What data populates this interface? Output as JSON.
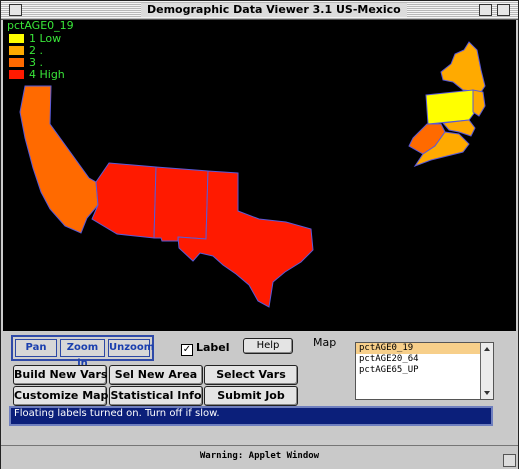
{
  "window": {
    "title": "Demographic Data Viewer 3.1 US-Mexico"
  },
  "map": {
    "variable_title": "pctAGE0_19",
    "legend": [
      {
        "label": "1  Low",
        "color": "#ffff00"
      },
      {
        "label": "2  .",
        "color": "#ffaa00"
      },
      {
        "label": "3  .",
        "color": "#ff6a00"
      },
      {
        "label": "4  High",
        "color": "#ff1a00"
      }
    ]
  },
  "nav": {
    "pan": "Pan",
    "zoom_in": "Zoom in",
    "unzoom": "Unzoom"
  },
  "label_toggle": {
    "label": "Label",
    "checked": true,
    "mark": "✓"
  },
  "help": "Help",
  "map_label": "Map",
  "buttons": {
    "build_new_vars": "Build New Vars",
    "sel_new_area": "Sel New Area",
    "select_vars": "Select Vars",
    "customize_map": "Customize Map",
    "statistical_info": "Statistical Info",
    "submit_job": "Submit Job"
  },
  "variables": [
    "pctAGE0_19",
    "pctAGE20_64",
    "pctAGE65_UP"
  ],
  "selected_variable": "pctAGE0_19",
  "status": "Floating labels turned on. Turn off if slow.",
  "footer_warning": "Warning: Applet Window"
}
